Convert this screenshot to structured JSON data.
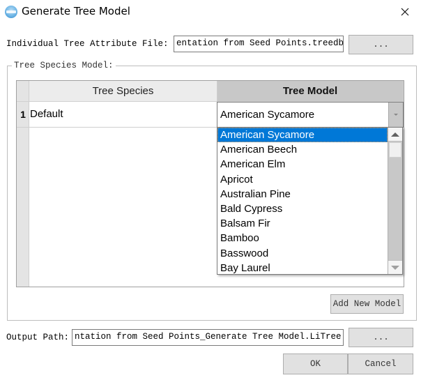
{
  "window": {
    "title": "Generate Tree Model",
    "icon": "app-logo-icon",
    "close_icon": "close-icon"
  },
  "attribute_file": {
    "label": "Individual Tree Attribute File:",
    "value": "entation from Seed Points.treedb",
    "browse_label": "..."
  },
  "species_model": {
    "group_label": "Tree Species Model:",
    "columns": [
      "Tree Species",
      "Tree Model"
    ],
    "rows": [
      {
        "index": "1",
        "species": "Default",
        "model": "American Sycamore"
      }
    ],
    "dropdown": {
      "selected": "American Sycamore",
      "options": [
        "American Sycamore",
        "American Beech",
        "American Elm",
        "Apricot",
        "Australian Pine",
        "Bald Cypress",
        "Balsam Fir",
        "Bamboo",
        "Basswood",
        "Bay Laurel"
      ]
    },
    "add_model_label": "Add New Model"
  },
  "output": {
    "label": "Output Path:",
    "value": "ntation from Seed Points_Generate Tree Model.LiTree",
    "browse_label": "..."
  },
  "actions": {
    "ok_label": "OK",
    "cancel_label": "Cancel"
  },
  "colors": {
    "selection": "#0078d7",
    "header_active": "#c8c8c8"
  }
}
